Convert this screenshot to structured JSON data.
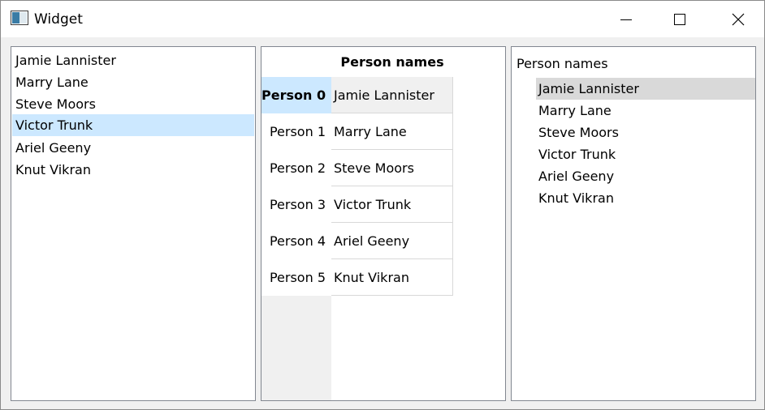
{
  "window": {
    "title": "Widget",
    "icon": "window-app-icon",
    "controls": [
      "minimize-icon",
      "maximize-icon",
      "close-icon"
    ]
  },
  "list_view": {
    "items": [
      "Jamie Lannister",
      "Marry Lane",
      "Steve Moors",
      "Victor Trunk",
      "Ariel Geeny",
      "Knut Vikran"
    ],
    "selected_index": 3
  },
  "table_view": {
    "column_header": "Person names",
    "row_headers": [
      "Person 0",
      "Person 1",
      "Person 2",
      "Person 3",
      "Person 4",
      "Person 5"
    ],
    "cells": [
      "Jamie Lannister",
      "Marry Lane",
      "Steve Moors",
      "Victor Trunk",
      "Ariel Geeny",
      "Knut Vikran"
    ],
    "current_row": 0
  },
  "tree_view": {
    "header": "Person names",
    "items": [
      "Jamie Lannister",
      "Marry Lane",
      "Steve Moors",
      "Victor Trunk",
      "Ariel Geeny",
      "Knut Vikran"
    ],
    "selected_index": 0
  },
  "colors": {
    "list_selection": "#cce8ff",
    "table_current_row_header": "#cce8ff",
    "table_current_cell": "#f0f0f0",
    "tree_selection": "#d9d9d9",
    "window_background": "#f0f0f0"
  }
}
